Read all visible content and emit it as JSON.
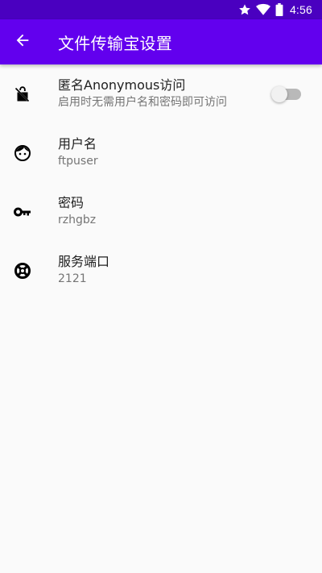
{
  "status_bar": {
    "time": "4:56",
    "icons": [
      "star-icon",
      "wifi-icon",
      "battery-icon"
    ]
  },
  "app_bar": {
    "back_icon": "arrow-back-icon",
    "title": "文件传输宝设置"
  },
  "preferences": [
    {
      "icon": "lock-off-icon",
      "title": "匿名Anonymous访问",
      "summary": "启用时无需用户名和密码即可访问",
      "switch_on": false
    },
    {
      "icon": "face-icon",
      "title": "用户名",
      "summary": "ftpuser"
    },
    {
      "icon": "key-icon",
      "title": "密码",
      "summary": "rzhgbz"
    },
    {
      "icon": "port-icon",
      "title": "服务端口",
      "summary": "2121"
    }
  ],
  "colors": {
    "status_bar": "#4a00c0",
    "app_bar": "#6200ee",
    "background": "#fafafa",
    "title_text": "#212121",
    "summary_text": "#757575"
  }
}
